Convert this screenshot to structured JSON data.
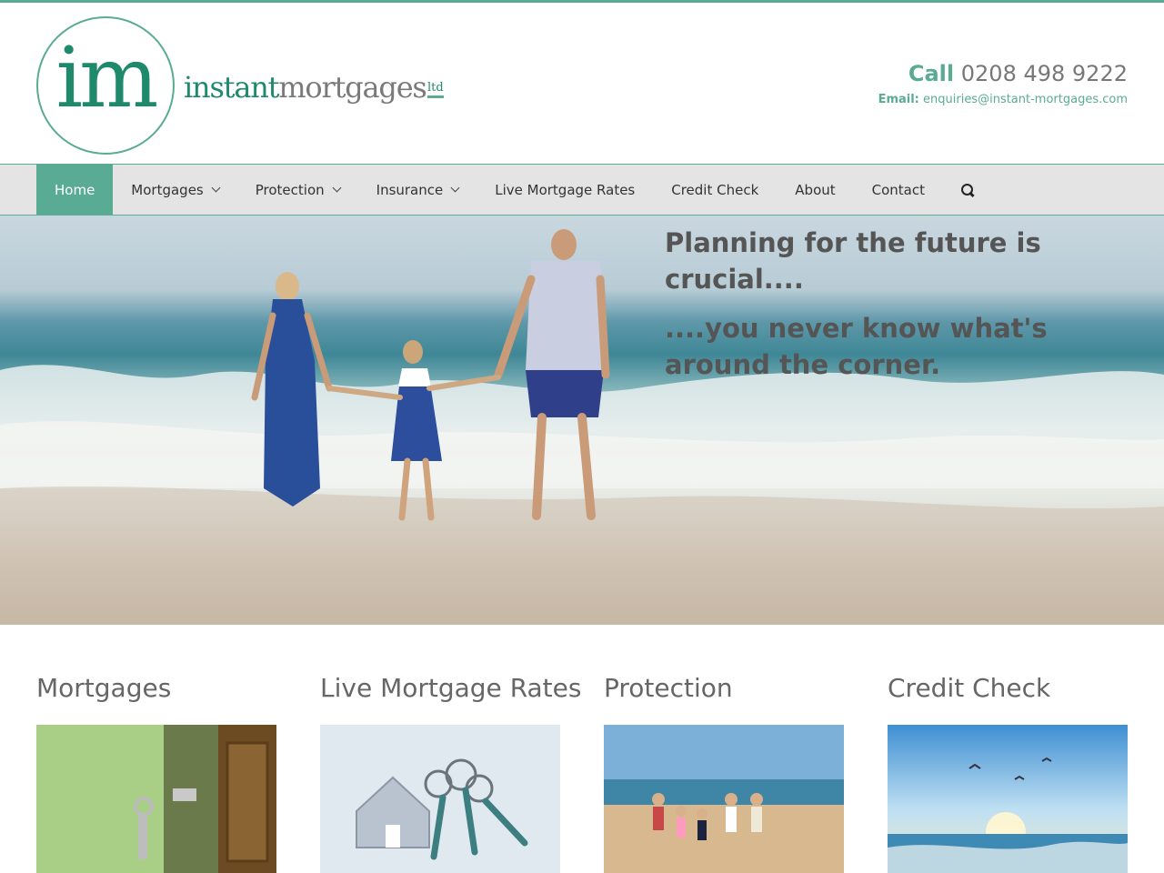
{
  "brand": {
    "monogram": "im",
    "name_part1": "instant",
    "name_part2": "mortgages",
    "suffix": "ltd",
    "accent_color": "#5aab93",
    "dark_green": "#1f8a6b"
  },
  "contact": {
    "call_label": "Call",
    "phone": "0208 498 9222",
    "email_label": "Email:",
    "email": "enquiries@instant-mortgages.com"
  },
  "nav": {
    "items": [
      {
        "label": "Home",
        "active": true
      },
      {
        "label": "Mortgages",
        "dropdown": true
      },
      {
        "label": "Protection",
        "dropdown": true
      },
      {
        "label": "Insurance",
        "dropdown": true
      },
      {
        "label": "Live Mortgage Rates"
      },
      {
        "label": "Credit Check"
      },
      {
        "label": "About"
      },
      {
        "label": "Contact"
      }
    ],
    "search_icon": "search-icon"
  },
  "hero": {
    "line1": "Planning for the future is crucial....",
    "line2": "....you never know what's around the corner."
  },
  "sections": [
    {
      "title": "Mortgages"
    },
    {
      "title": "Live Mortgage Rates"
    },
    {
      "title": "Protection"
    },
    {
      "title": "Credit Check"
    }
  ]
}
